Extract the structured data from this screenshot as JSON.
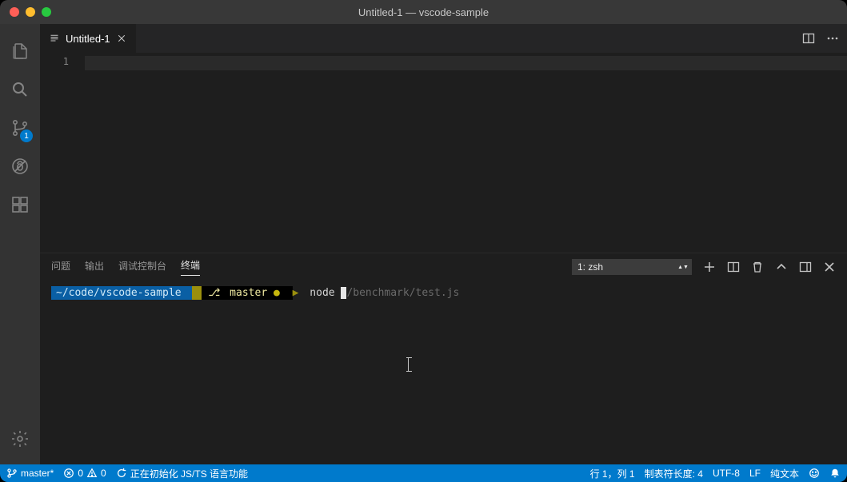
{
  "titlebar": {
    "title": "Untitled-1 — vscode-sample"
  },
  "activitybar": {
    "scm_badge": "1"
  },
  "tab": {
    "label": "Untitled-1"
  },
  "editor": {
    "line_number": "1"
  },
  "panel": {
    "tabs": {
      "problems": "问题",
      "output": "输出",
      "debug": "调试控制台",
      "terminal": "终端"
    },
    "terminal_select": "1: zsh"
  },
  "terminal": {
    "cwd": " ~/code/vscode-sample ",
    "branch": " master ",
    "dot": "● ",
    "cmd": "node ",
    "hint": "/benchmark/test.js"
  },
  "status": {
    "branch": "master*",
    "errors": "0",
    "warnings": "0",
    "initializing": "正在初始化 JS/TS 语言功能",
    "line_col": "行 1，列 1",
    "tab_size": "制表符长度: 4",
    "encoding": "UTF-8",
    "eol": "LF",
    "lang": "纯文本"
  }
}
